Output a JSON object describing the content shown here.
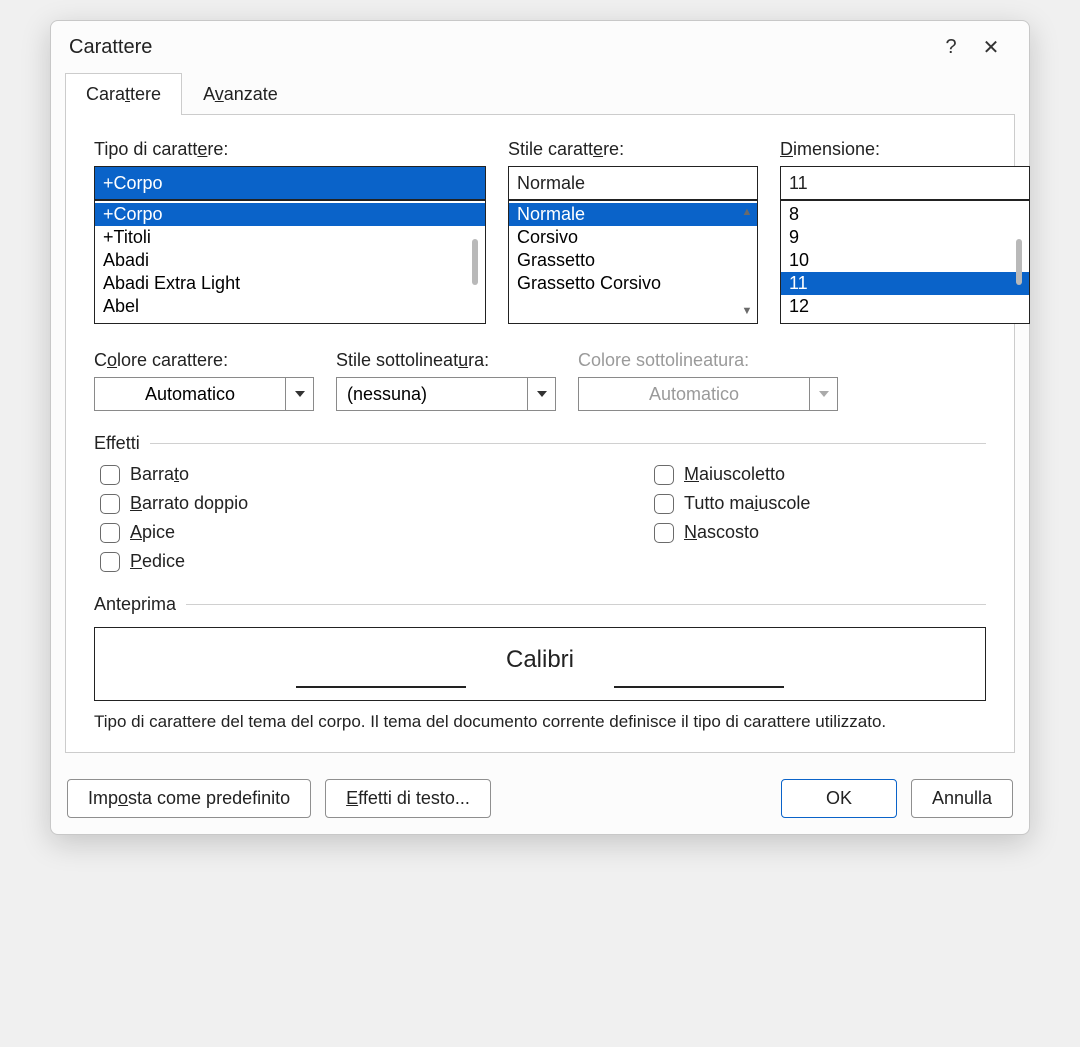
{
  "title": "Carattere",
  "help_glyph": "?",
  "close_glyph": "✕",
  "tabs": {
    "font": "Carattere",
    "font_u": "t",
    "adv": "Avanzate",
    "adv_u": "v"
  },
  "font_section": {
    "label": "Tipo di carattere:",
    "label_u": "e",
    "value": "+Corpo",
    "list": [
      "+Corpo",
      "+Titoli",
      "Abadi",
      "Abadi Extra Light",
      "Abel"
    ],
    "selected": "+Corpo"
  },
  "style_section": {
    "label": "Stile carattere:",
    "label_u": "e",
    "value": "Normale",
    "list": [
      "Normale",
      "Corsivo",
      "Grassetto",
      "Grassetto Corsivo"
    ],
    "selected": "Normale"
  },
  "size_section": {
    "label": "Dimensione:",
    "label_u": "D",
    "value": "11",
    "list": [
      "8",
      "9",
      "10",
      "11",
      "12"
    ],
    "selected": "11"
  },
  "color": {
    "label": "Colore carattere:",
    "label_u": "o",
    "value": "Automatico"
  },
  "underline_style": {
    "label": "Stile sottolineatura:",
    "label_u": "u",
    "value": "(nessuna)"
  },
  "underline_color": {
    "label": "Colore sottolineatura:",
    "value": "Automatico"
  },
  "effects": {
    "legend": "Effetti",
    "left": [
      {
        "text": "Barrato",
        "u": "t"
      },
      {
        "text": "Barrato doppio",
        "u": "B"
      },
      {
        "text": "Apice",
        "u": "A"
      },
      {
        "text": "Pedice",
        "u": "P"
      }
    ],
    "right": [
      {
        "text": "Maiuscoletto",
        "u": "M"
      },
      {
        "text": "Tutto maiuscole",
        "u": "i"
      },
      {
        "text": "Nascosto",
        "u": "N"
      }
    ]
  },
  "preview": {
    "legend": "Anteprima",
    "text": "Calibri",
    "desc": "Tipo di carattere del tema del corpo. Il tema del documento corrente definisce il tipo di carattere utilizzato."
  },
  "footer": {
    "default": "Imposta come predefinito",
    "default_u": "o",
    "text_effects": "Effetti di testo...",
    "text_effects_u": "E",
    "ok": "OK",
    "cancel": "Annulla"
  }
}
